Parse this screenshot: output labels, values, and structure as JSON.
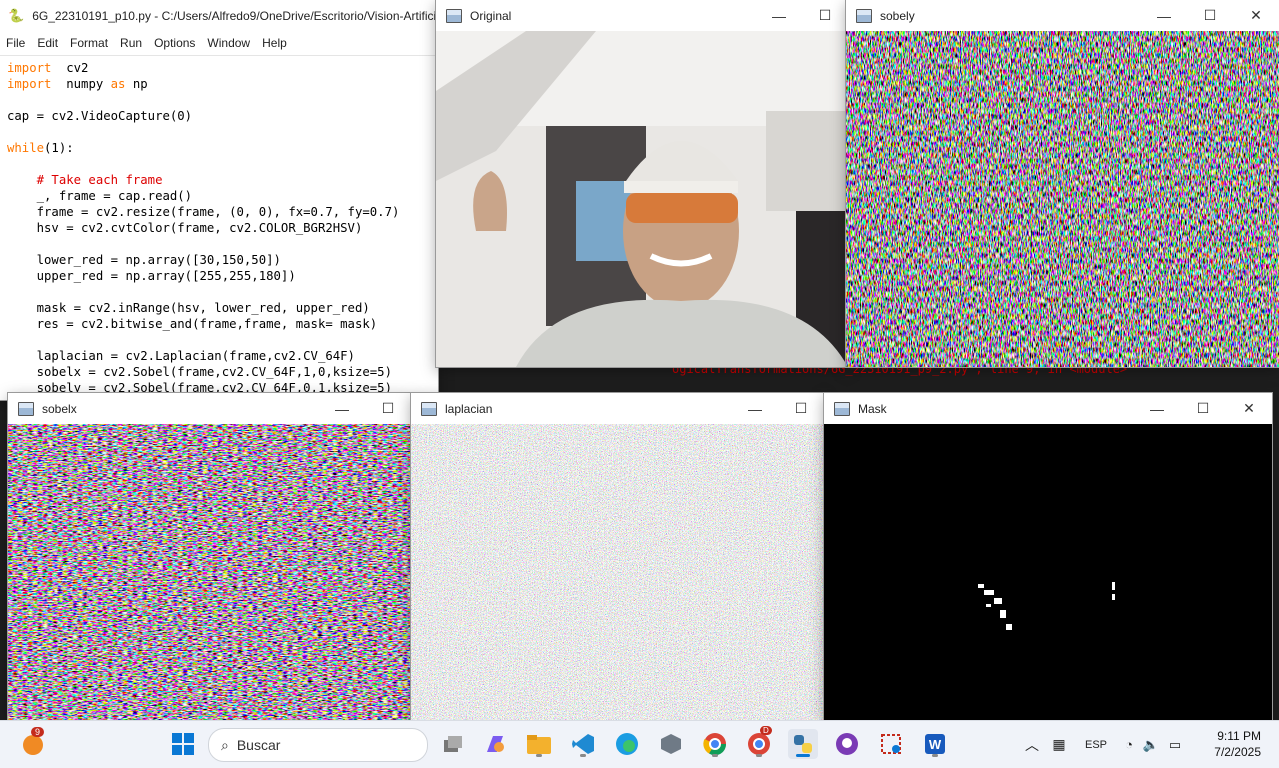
{
  "idle": {
    "title": "6G_22310191_p10.py - C:/Users/Alfredo9/OneDrive/Escritorio/Vision-Artificia",
    "menu": [
      "File",
      "Edit",
      "Format",
      "Run",
      "Options",
      "Window",
      "Help"
    ],
    "code": [
      [
        [
          "kw",
          "import"
        ],
        [
          "",
          "  cv2"
        ]
      ],
      [
        [
          "kw",
          "import"
        ],
        [
          "",
          "  numpy "
        ],
        [
          "kw",
          "as"
        ],
        [
          "",
          " np"
        ]
      ],
      [
        [
          "",
          ""
        ]
      ],
      [
        [
          "",
          "cap = cv2.VideoCapture(0)"
        ]
      ],
      [
        [
          "",
          ""
        ]
      ],
      [
        [
          "kw",
          "while"
        ],
        [
          "",
          "(1):"
        ]
      ],
      [
        [
          "",
          ""
        ]
      ],
      [
        [
          "cm",
          "    # Take each frame"
        ]
      ],
      [
        [
          "",
          "    _, frame = cap.read()"
        ]
      ],
      [
        [
          "",
          "    frame = cv2.resize(frame, (0, 0), fx=0.7, fy=0.7)"
        ]
      ],
      [
        [
          "",
          "    hsv = cv2.cvtColor(frame, cv2.COLOR_BGR2HSV)"
        ]
      ],
      [
        [
          "",
          ""
        ]
      ],
      [
        [
          "",
          "    lower_red = np.array([30,150,50])"
        ]
      ],
      [
        [
          "",
          "    upper_red = np.array([255,255,180])"
        ]
      ],
      [
        [
          "",
          ""
        ]
      ],
      [
        [
          "",
          "    mask = cv2.inRange(hsv, lower_red, upper_red)"
        ]
      ],
      [
        [
          "",
          "    res = cv2.bitwise_and(frame,frame, mask= mask)"
        ]
      ],
      [
        [
          "",
          ""
        ]
      ],
      [
        [
          "",
          "    laplacian = cv2.Laplacian(frame,cv2.CV_64F)"
        ]
      ],
      [
        [
          "",
          "    sobelx = cv2.Sobel(frame,cv2.CV_64F,1,0,ksize=5)"
        ]
      ],
      [
        [
          "",
          "    sobely = cv2.Sobel(frame,cv2.CV_64F,0,1,ksize=5)"
        ]
      ]
    ]
  },
  "shell_error_fragment": "ogicalTransformations/6G_22310191_p9_2.py\", line 9, in <module>",
  "windows": {
    "original": {
      "title": "Original"
    },
    "sobely": {
      "title": "sobely"
    },
    "sobelx": {
      "title": "sobelx"
    },
    "laplacian": {
      "title": "laplacian"
    },
    "mask": {
      "title": "Mask"
    }
  },
  "controls": {
    "minimize": "—",
    "maximize": "☐",
    "close": "✕"
  },
  "taskbar": {
    "search_placeholder": "Buscar",
    "lang": "ESP",
    "time": "9:11 PM",
    "date": "7/2/2025",
    "badge_count": "9",
    "chrome_badge": "D"
  },
  "colors": {
    "idle_keyword": "#ff7700",
    "idle_comment": "#dd0000",
    "taskbar_bg": "#f0f3f9"
  }
}
